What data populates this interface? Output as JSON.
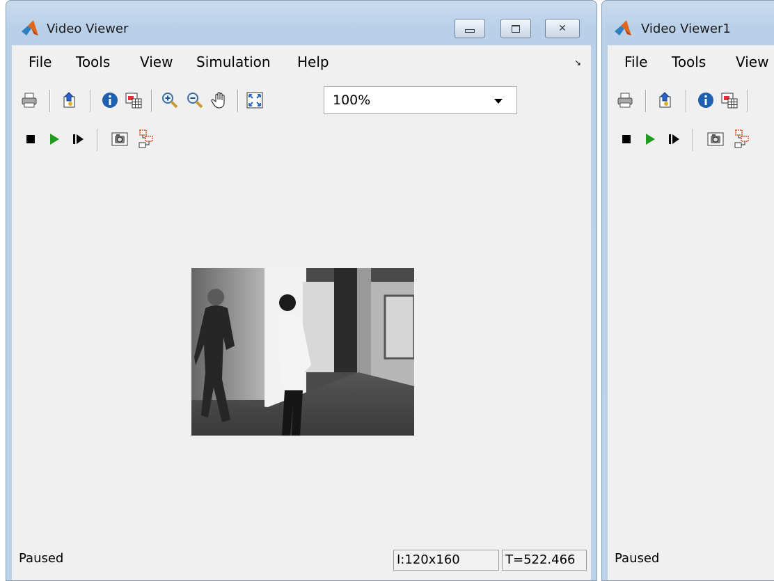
{
  "windows": [
    {
      "title": "Video Viewer",
      "menu": [
        "File",
        "Tools",
        "View",
        "Simulation",
        "Help"
      ],
      "zoom": {
        "value": "100%"
      },
      "status": {
        "state": "Paused",
        "image_info": "I:120x160",
        "time": "T=522.466"
      }
    },
    {
      "title": "Video Viewer1",
      "menu": [
        "File",
        "Tools",
        "View"
      ],
      "status": {
        "state": "Paused"
      }
    }
  ],
  "toolbar_icons": [
    "print-icon",
    "parameters-icon",
    "info-icon",
    "pixel-region-icon",
    "zoom-in-icon",
    "zoom-out-icon",
    "pan-icon",
    "fit-to-view-icon"
  ],
  "playback_icons": [
    "stop-icon",
    "play-icon",
    "step-forward-icon",
    "snapshot-icon",
    "highlight-block-icon"
  ],
  "colors": {
    "title_bar": "#c4d8ee",
    "client": "#f0f0f0",
    "play": "#1f9a1f",
    "info": "#1f5fb0"
  }
}
